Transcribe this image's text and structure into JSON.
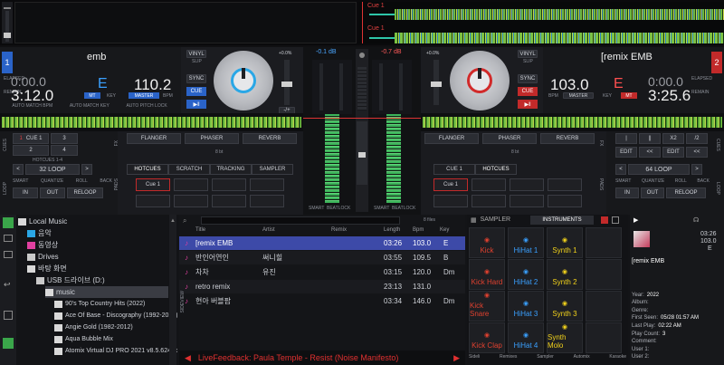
{
  "top_strip": {
    "cue_label_left": "Cue 1",
    "cue_label_right": "Cue 1"
  },
  "left_deck": {
    "deck_number": "1",
    "title": "emb",
    "elapsed_label": "ELAPSED",
    "remain_label": "REMAIN",
    "elapsed": "0:00.0",
    "remain": "3:12.0",
    "key": "E",
    "key_tag": "MT",
    "key_label": "KEY",
    "bpm": "110.2",
    "master_label": "MASTER",
    "bpm_label": "BPM",
    "auto_labels": [
      "AUTO MATCH BPM",
      "AUTO MATCH KEY",
      "AUTO PITCH LOCK"
    ],
    "vinyl_label": "VINYL",
    "slip_label": "SLIP",
    "sync_label": "SYNC",
    "cue_label": "CUE",
    "play_label": "▶‖",
    "pitch": "+0.0%",
    "pitch_minus": "-/+",
    "cues": [
      {
        "n": "1",
        "label": "CUE 1"
      },
      {
        "n": "2",
        "label": ""
      },
      {
        "n": "3",
        "label": ""
      },
      {
        "n": "4",
        "label": ""
      }
    ],
    "hotcues_label": "HOTCUES 1-4",
    "loop_label": "32 LOOP",
    "loop_in": "IN",
    "loop_out": "OUT",
    "reloop": "RELOOP",
    "smart_labels": [
      "SMART",
      "QUANTIZE",
      "ROLL",
      "BACK"
    ],
    "side_labels": {
      "cues": "CUES",
      "loop": "LOOP",
      "fx": "FX",
      "pads": "PADS"
    },
    "fx": [
      "FLANGER",
      "PHASER",
      "REVERB"
    ],
    "fx_beat": "8 bt",
    "pad_tabs": [
      "HOTCUES",
      "SCRATCH",
      "TRACKING",
      "SAMPLER"
    ],
    "pad_cue": "Cue 1"
  },
  "right_deck": {
    "deck_number": "2",
    "title": "[remix EMB",
    "elapsed": "0:00.0",
    "remain": "3:25.6",
    "key": "E",
    "key_tag": "MT",
    "key_label": "KEY",
    "bpm": "103.0",
    "master_label": "MASTER",
    "bpm_label": "BPM",
    "elapsed_label": "ELAPSED",
    "remain_label": "REMAIN",
    "vinyl_label": "VINYL",
    "slip_label": "SLIP",
    "sync_label": "SYNC",
    "cue_label": "CUE",
    "play_label": "▶‖",
    "pitch": "+0.0%",
    "cues": [
      {
        "n": "1",
        "label": "|"
      },
      {
        "n": "2",
        "label": "||"
      },
      {
        "n": "3",
        "label": "X2"
      },
      {
        "n": "4",
        "label": "/2"
      }
    ],
    "edit_row": [
      "EDIT",
      "<<",
      "EDIT",
      "<<"
    ],
    "loop_label": "64 LOOP",
    "loop_in": "IN",
    "loop_out": "OUT",
    "reloop": "RELOOP",
    "smart_labels": [
      "SMART",
      "QUANTIZE",
      "ROLL",
      "BACK"
    ],
    "fx": [
      "FLANGER",
      "PHASER",
      "REVERB"
    ],
    "fx_beat": "8 bt",
    "pad_tabs": [
      "CUE 1",
      "HOTCUES"
    ],
    "pad_cue": "Cue 1",
    "side_labels": {
      "cues": "CUES",
      "loop": "LOOP",
      "fx": "FX",
      "pads": "PADS"
    }
  },
  "mixer": {
    "gain_left": "-0.1 dB",
    "gain_right": "-0.7 dB",
    "smart_left": "SMART",
    "beatlock_left": "BEATLOCK",
    "smart_right": "SMART",
    "beatlock_right": "BEATLOCK"
  },
  "browser": {
    "tree": [
      {
        "label": "Local Music",
        "indent": 0,
        "icon": "folder"
      },
      {
        "label": "음악",
        "indent": 1,
        "icon": "music"
      },
      {
        "label": "동영상",
        "indent": 1,
        "icon": "video"
      },
      {
        "label": "Drives",
        "indent": 1,
        "icon": "drive"
      },
      {
        "label": "바탕 화면",
        "indent": 1,
        "icon": "folder"
      },
      {
        "label": "USB 드라이브 (D:)",
        "indent": 2,
        "icon": "drive"
      },
      {
        "label": "music",
        "indent": 3,
        "icon": "folder"
      },
      {
        "label": "90's Top Country Hits (2022)",
        "indent": 4,
        "icon": "folder"
      },
      {
        "label": "Ace Of Base - Discography (1992-2015)",
        "indent": 4,
        "icon": "folder"
      },
      {
        "label": "Angie Gold (1982-2012)",
        "indent": 4,
        "icon": "folder"
      },
      {
        "label": "Aqua Bubble Mix",
        "indent": 4,
        "icon": "folder"
      },
      {
        "label": "Atomix Virtual DJ PRO 2021 v8.5.6242 x",
        "indent": 4,
        "icon": "folder"
      }
    ],
    "search_placeholder": "",
    "file_count": "8 files",
    "columns": [
      "Title",
      "Artist",
      "Remix",
      "Length",
      "Bpm",
      "Key"
    ],
    "tracks": [
      {
        "title": "[remix EMB",
        "artist": "",
        "remix": "",
        "length": "03:26",
        "bpm": "103.0",
        "key": "E",
        "selected": true
      },
      {
        "title": "반인어연인",
        "artist": "써니힐",
        "remix": "",
        "length": "03:55",
        "bpm": "109.5",
        "key": "B",
        "selected": false
      },
      {
        "title": "차차",
        "artist": "유진",
        "remix": "",
        "length": "03:15",
        "bpm": "120.0",
        "key": "Dm",
        "selected": false
      },
      {
        "title": "retro remix",
        "artist": "",
        "remix": "",
        "length": "23:13",
        "bpm": "131.0",
        "key": "",
        "selected": false
      },
      {
        "title": "현아 버블팝",
        "artist": "",
        "remix": "",
        "length": "03:34",
        "bpm": "146.0",
        "key": "Dm",
        "selected": false
      }
    ],
    "live_feedback": "LiveFeedback: Paula Temple - Resist (Noise Manifesto)",
    "side_label": "SIDEVIEW"
  },
  "sampler": {
    "title": "SAMPLER",
    "bank": "INSTRUMENTS",
    "pads": [
      {
        "label": "Kick",
        "color": "#e0412f"
      },
      {
        "label": "HiHat 1",
        "color": "#3aa0ff"
      },
      {
        "label": "Synth 1",
        "color": "#f2d21b"
      },
      {
        "label": "",
        "color": ""
      },
      {
        "label": "Kick Hard",
        "color": "#e0412f"
      },
      {
        "label": "HiHat 2",
        "color": "#3aa0ff"
      },
      {
        "label": "Synth 2",
        "color": "#f2d21b"
      },
      {
        "label": "",
        "color": ""
      },
      {
        "label": "Kick Snare",
        "color": "#e0412f"
      },
      {
        "label": "HiHat 3",
        "color": "#3aa0ff"
      },
      {
        "label": "Synth 3",
        "color": "#f2d21b"
      },
      {
        "label": "",
        "color": ""
      },
      {
        "label": "Kick Clap",
        "color": "#e0412f"
      },
      {
        "label": "HiHat 4",
        "color": "#3aa0ff"
      },
      {
        "label": "Synth Molo",
        "color": "#f2d21b"
      },
      {
        "label": "",
        "color": ""
      }
    ],
    "tabs": [
      "Sideli",
      "Remixes",
      "Sampler",
      "Automix",
      "Karaoke"
    ]
  },
  "info": {
    "time": "03:26",
    "bpm": "103.0",
    "key": "E",
    "title": "[remix EMB",
    "fields": [
      {
        "label": "Year:",
        "value": "2022"
      },
      {
        "label": "Album:",
        "value": ""
      },
      {
        "label": "Genre:",
        "value": ""
      },
      {
        "label": "First Seen:",
        "value": "05/28 01:57 AM"
      },
      {
        "label": "Last Play:",
        "value": "02:22 AM"
      },
      {
        "label": "Play Count:",
        "value": "3"
      },
      {
        "label": "Comment:",
        "value": ""
      },
      {
        "label": "User 1:",
        "value": ""
      },
      {
        "label": "User 2:",
        "value": ""
      }
    ]
  },
  "colors": {
    "accent_blue": "#2a63c8",
    "accent_red": "#c22a2a",
    "selected_row": "#3d4aa8",
    "wave_green": "#7cc243"
  }
}
